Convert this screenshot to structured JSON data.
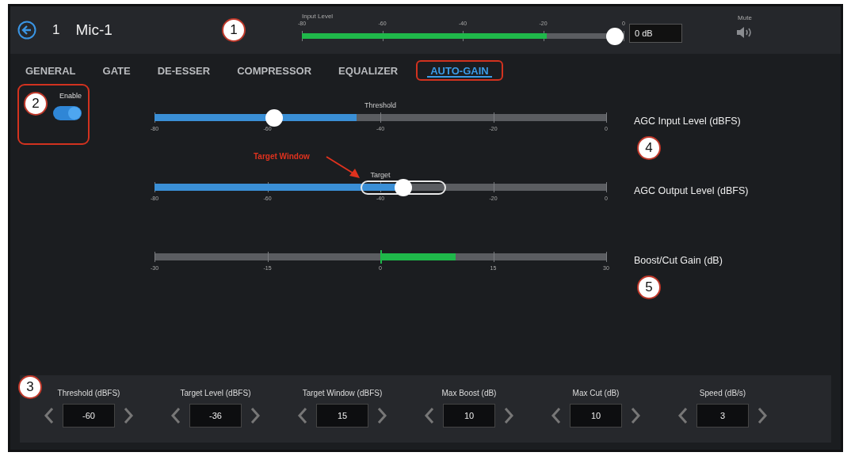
{
  "header": {
    "channel_number": "1",
    "channel_name": "Mic-1",
    "callout": "1",
    "input_level": {
      "label": "Input Level",
      "ticks": [
        "-80",
        "-60",
        "-40",
        "-20",
        "0"
      ],
      "meter": {
        "level": 0.76
      },
      "fader": {
        "level": 1.0
      },
      "value": "0 dB"
    },
    "mute": {
      "label": "Mute",
      "muted": false
    }
  },
  "tabs": [
    {
      "label": "GENERAL",
      "selected": false,
      "highlighted": false
    },
    {
      "label": "GATE",
      "selected": false,
      "highlighted": false
    },
    {
      "label": "DE-ESSER",
      "selected": false,
      "highlighted": false
    },
    {
      "label": "COMPRESSOR",
      "selected": false,
      "highlighted": false
    },
    {
      "label": "EQUALIZER",
      "selected": false,
      "highlighted": false
    },
    {
      "label": "AUTO-GAIN",
      "selected": true,
      "highlighted": true
    }
  ],
  "enable": {
    "label": "Enable",
    "on": true,
    "highlighted": true,
    "callout": "2"
  },
  "sliders": [
    {
      "kind": "level",
      "caption": "Threshold",
      "ticks": [
        "-80",
        "-60",
        "-40",
        "-20",
        "0"
      ],
      "fill": {
        "level": 0.447
      },
      "thumb": {
        "level": 0.256
      },
      "side_label": "AGC Input Level (dBFS)",
      "callout": "4"
    },
    {
      "kind": "level",
      "caption": "Target",
      "ticks": [
        "-80",
        "-60",
        "-40",
        "-20",
        "0"
      ],
      "fill": {
        "level": 0.54
      },
      "thumb": {
        "level": 0.553
      },
      "window": true,
      "pointer_label": "Target Window",
      "side_label": "AGC Output Level (dBFS)"
    },
    {
      "kind": "gain",
      "ticks": [
        "-30",
        "-15",
        "0",
        "15",
        "30"
      ],
      "fill": true,
      "side_label": "Boost/Cut Gain (dB)",
      "callout": "5"
    }
  ],
  "params": {
    "callout": "3",
    "items": [
      {
        "label": "Threshold (dBFS)",
        "value": "-60"
      },
      {
        "label": "Target Level (dBFS)",
        "value": "-36"
      },
      {
        "label": "Target Window (dBFS)",
        "value": "15"
      },
      {
        "label": "Max Boost (dB)",
        "value": "10"
      },
      {
        "label": "Max Cut (dB)",
        "value": "10"
      },
      {
        "label": "Speed (dB/s)",
        "value": "3"
      }
    ]
  }
}
